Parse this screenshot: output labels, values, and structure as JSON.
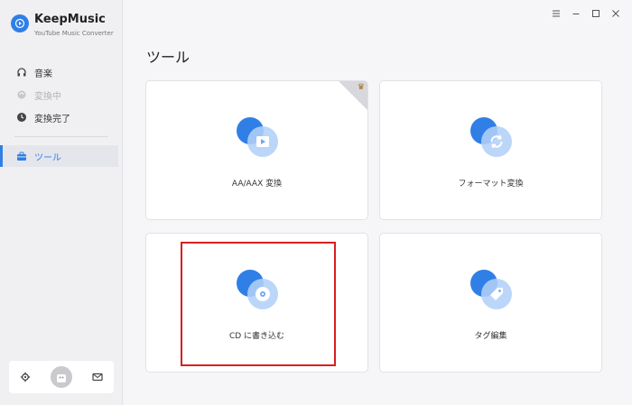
{
  "app": {
    "name": "KeepMusic",
    "subtitle": "YouTube Music Converter"
  },
  "sidebar": {
    "items": [
      {
        "label": "音楽",
        "icon": "headphones-icon",
        "enabled": true
      },
      {
        "label": "変換中",
        "icon": "converting-icon",
        "enabled": false
      },
      {
        "label": "変換完了",
        "icon": "clock-icon",
        "enabled": true
      }
    ],
    "tools_label": "ツール",
    "tools_icon": "toolbox-icon"
  },
  "bottom": {
    "settings_icon": "gear-icon",
    "avatar_icon": "avatar-icon",
    "mail_icon": "mail-icon"
  },
  "window_controls": [
    "menu-icon",
    "minimize-icon",
    "maximize-icon",
    "close-icon"
  ],
  "main": {
    "title": "ツール",
    "cards": [
      {
        "label": "AA/AAX 変換",
        "icon": "play-video-icon",
        "premium": true
      },
      {
        "label": "フォーマット変換",
        "icon": "convert-icon",
        "premium": false
      },
      {
        "label": "CD に書き込む",
        "icon": "cd-icon",
        "premium": false
      },
      {
        "label": "タグ編集",
        "icon": "tag-icon",
        "premium": false
      }
    ]
  },
  "colors": {
    "accent": "#2f7fe6",
    "highlight": "#d91f1f"
  }
}
